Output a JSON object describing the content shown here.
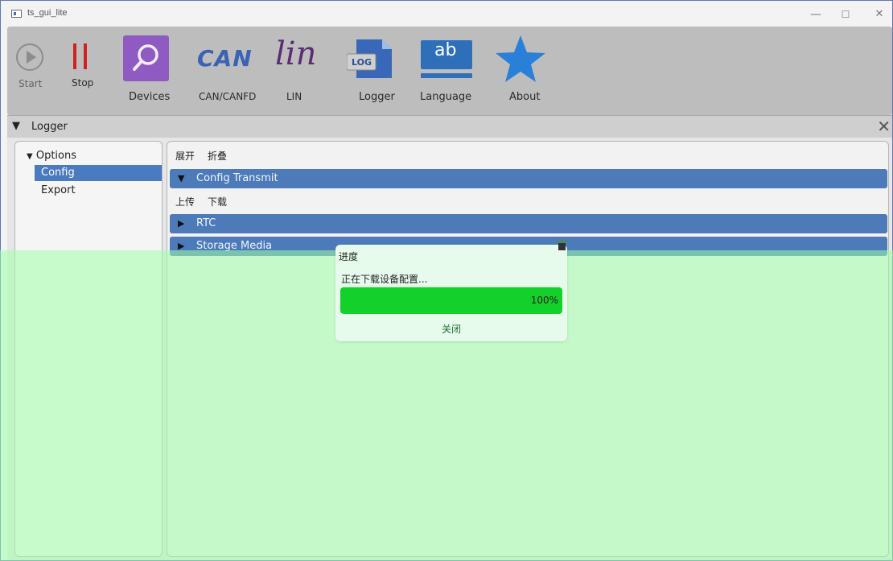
{
  "window": {
    "title": "ts_gui_lite",
    "controls": {
      "minimize": "—",
      "maximize": "☐",
      "close": "✕"
    }
  },
  "toolbar": {
    "start_label": "Start",
    "stop_label": "Stop",
    "devices_label": "Devices",
    "can_icon_text": "CAN",
    "can_label": "CAN/CANFD",
    "lin_icon_text": "lin",
    "lin_label": "LIN",
    "logger_icon_text": "LOG",
    "logger_label": "Logger",
    "language_icon_text": "ab",
    "language_label": "Language",
    "about_label": "About"
  },
  "logger_panel": {
    "title": "Logger",
    "close": "✕"
  },
  "sidebar": {
    "root": "Options",
    "items": [
      {
        "label": "Config",
        "selected": true
      },
      {
        "label": "Export",
        "selected": false
      }
    ]
  },
  "main": {
    "expand_label": "展开",
    "collapse_label": "折叠",
    "sections": [
      {
        "label": "Config Transmit",
        "expanded": true
      },
      {
        "label": "RTC",
        "expanded": false
      },
      {
        "label": "Storage Media",
        "expanded": false
      }
    ],
    "upload_label": "上传",
    "download_label": "下载"
  },
  "dialog": {
    "title": "进度",
    "message": "正在下载设备配置...",
    "progress_value": 100,
    "progress_text": "100%",
    "close_label": "关闭"
  },
  "colors": {
    "section_bar": "#4d7ab8",
    "selection": "#4a7abf",
    "progress_fill": "#14d02a",
    "overlay": "#a0ffaa",
    "devices_icon": "#8f5bc2",
    "can_text": "#3a62b5",
    "lin_text": "#5a2d73",
    "stop_icon": "#d02020",
    "about_star": "#2a80d8"
  }
}
